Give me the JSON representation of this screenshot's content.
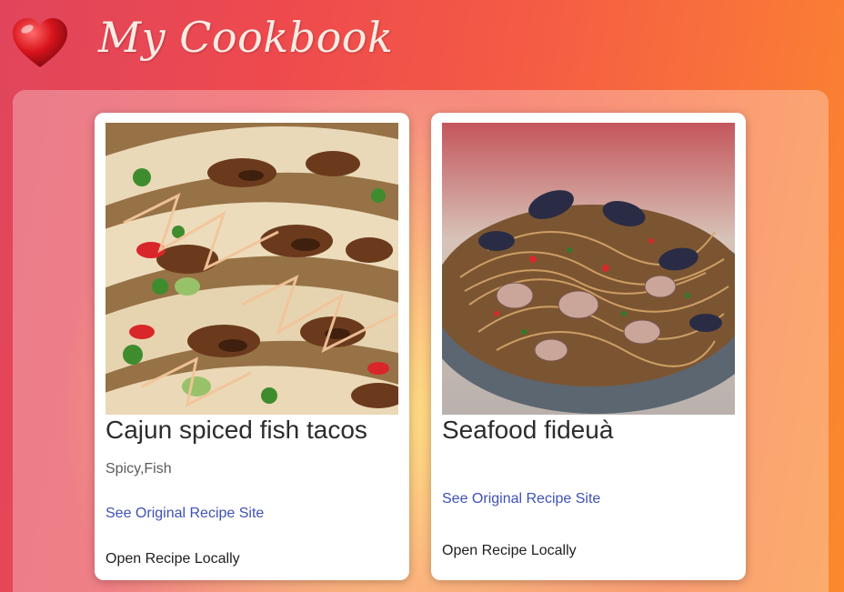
{
  "header": {
    "title": "My Cookbook",
    "icon": "heart-icon",
    "icon_color": "#d81b23"
  },
  "recipes": [
    {
      "title": "Cajun spiced fish tacos",
      "tags": "Spicy,Fish",
      "link_label": "See Original Recipe Site",
      "local_label": "Open Recipe Locally",
      "image_icon": "fish-tacos-photo"
    },
    {
      "title": "Seafood fideuà",
      "tags": "",
      "link_label": "See Original Recipe Site",
      "local_label": "Open Recipe Locally",
      "image_icon": "seafood-pasta-photo"
    }
  ],
  "colors": {
    "link": "#3f51b5",
    "card_background": "#ffffff"
  }
}
